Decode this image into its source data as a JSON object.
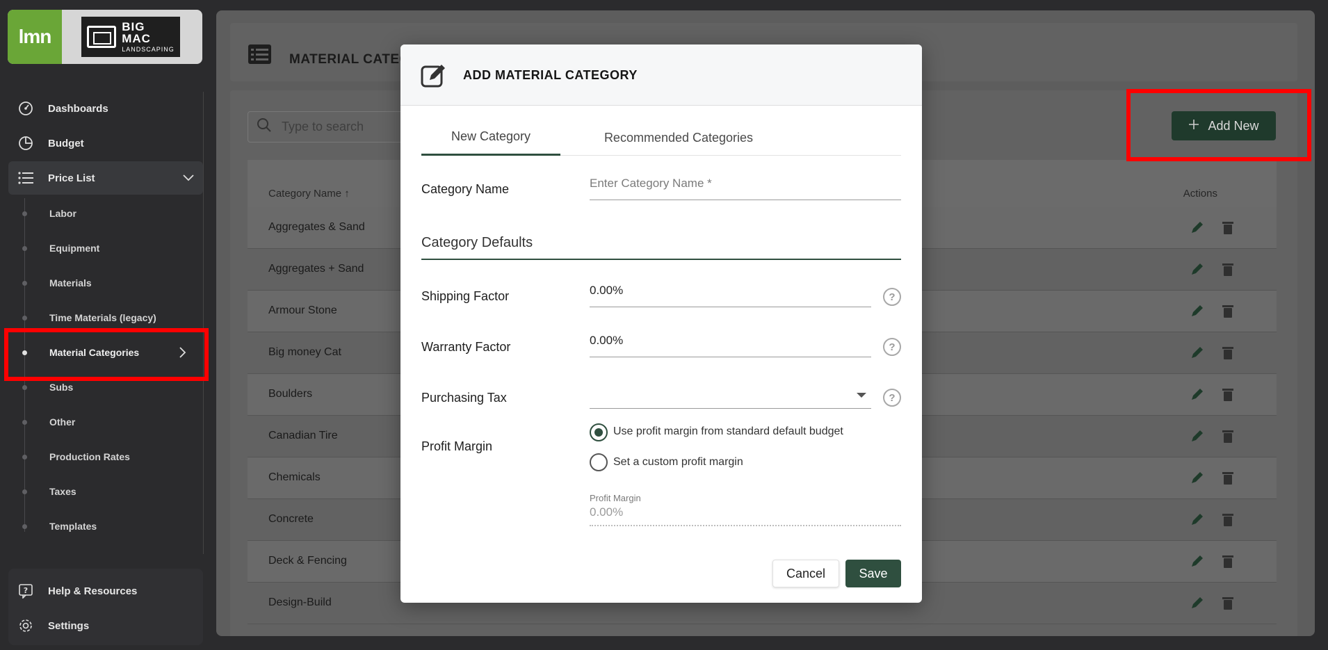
{
  "sidebar": {
    "logo_left": "lmn",
    "logo_brand_top": "BIG",
    "logo_brand_mid": "MAC",
    "logo_brand_bottom": "LANDSCAPING",
    "items": [
      {
        "label": "Dashboards",
        "icon": "dashboard-icon"
      },
      {
        "label": "Budget",
        "icon": "pie-chart-icon"
      },
      {
        "label": "Price List",
        "icon": "list-icon"
      }
    ],
    "sub_items": [
      {
        "label": "Labor"
      },
      {
        "label": "Equipment"
      },
      {
        "label": "Materials"
      },
      {
        "label": "Time Materials (legacy)"
      },
      {
        "label": "Material Categories",
        "selected": true
      },
      {
        "label": "Subs"
      },
      {
        "label": "Other"
      },
      {
        "label": "Production Rates"
      },
      {
        "label": "Taxes"
      },
      {
        "label": "Templates"
      }
    ],
    "bottom_items": [
      {
        "label": "Help & Resources",
        "icon": "help-icon"
      },
      {
        "label": "Settings",
        "icon": "gear-icon"
      }
    ]
  },
  "main": {
    "title": "MATERIAL CATEGO",
    "search_placeholder": "Type to search",
    "add_new_label": "Add New",
    "table": {
      "col_name": "Category Name",
      "col_actions": "Actions",
      "rows": [
        "Aggregates & Sand",
        "Aggregates + Sand",
        "Armour Stone",
        "Big money Cat",
        "Boulders",
        "Canadian Tire",
        "Chemicals",
        "Concrete",
        "Deck & Fencing",
        "Design-Build"
      ]
    }
  },
  "modal": {
    "title": "ADD MATERIAL CATEGORY",
    "tabs": [
      "New Category",
      "Recommended Categories"
    ],
    "category_name_label": "Category Name",
    "category_name_placeholder": "Enter Category Name *",
    "defaults_title": "Category Defaults",
    "shipping_label": "Shipping Factor",
    "shipping_value": "0.00%",
    "warranty_label": "Warranty Factor",
    "warranty_value": "0.00%",
    "purchasing_tax_label": "Purchasing Tax",
    "purchasing_tax_value": "",
    "profit_margin_label": "Profit Margin",
    "radio_default": "Use profit margin from standard default budget",
    "radio_custom": "Set a custom profit margin",
    "profit_margin_field_label": "Profit Margin",
    "profit_margin_field_value": "0.00%",
    "cancel_label": "Cancel",
    "save_label": "Save"
  },
  "colors": {
    "accent": "#2f4f3f",
    "highlight": "#ff0000",
    "logo_green": "#6aa637"
  }
}
